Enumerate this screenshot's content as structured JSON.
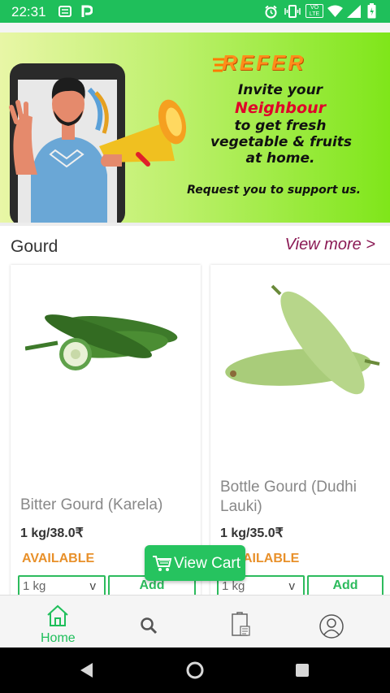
{
  "status_bar": {
    "time": "22:31",
    "lte_label": "VO LTE",
    "icons": [
      "message-icon",
      "paytm-icon",
      "alarm-icon",
      "vibrate-icon",
      "lte-icon",
      "wifi-icon",
      "signal-icon",
      "battery-icon"
    ],
    "background": "#1fbf5b"
  },
  "banner": {
    "headline": "REFER",
    "lines": [
      "Invite your",
      "Neighbour",
      "to get fresh",
      "vegetable & fruits",
      "at home."
    ],
    "request": "Request you to support us.",
    "highlight_color": "#e0002a",
    "slides": 3,
    "active_slide": 3
  },
  "section": {
    "title": "Gourd",
    "view_more": "View more >"
  },
  "products": [
    {
      "name": "Bitter Gourd (Karela)",
      "price": "1 kg/38.0₹",
      "availability": "AVAILABLE",
      "quantity": "1 kg",
      "dropdown_glyph": "v",
      "add_label": "Add"
    },
    {
      "name": "Bottle Gourd (Dudhi Lauki)",
      "price": "1 kg/35.0₹",
      "availability": "AILABLE",
      "quantity": "1 kg",
      "dropdown_glyph": "v",
      "add_label": "Add"
    }
  ],
  "view_cart": {
    "label": "View Cart"
  },
  "bottom_nav": {
    "items": [
      {
        "icon": "home-icon",
        "label": "Home",
        "active": true
      },
      {
        "icon": "search-icon"
      },
      {
        "icon": "orders-icon"
      },
      {
        "icon": "profile-icon"
      }
    ],
    "active_color": "#1fbf5b"
  },
  "system_nav": [
    "back-icon",
    "home-circle-icon",
    "recents-icon"
  ]
}
